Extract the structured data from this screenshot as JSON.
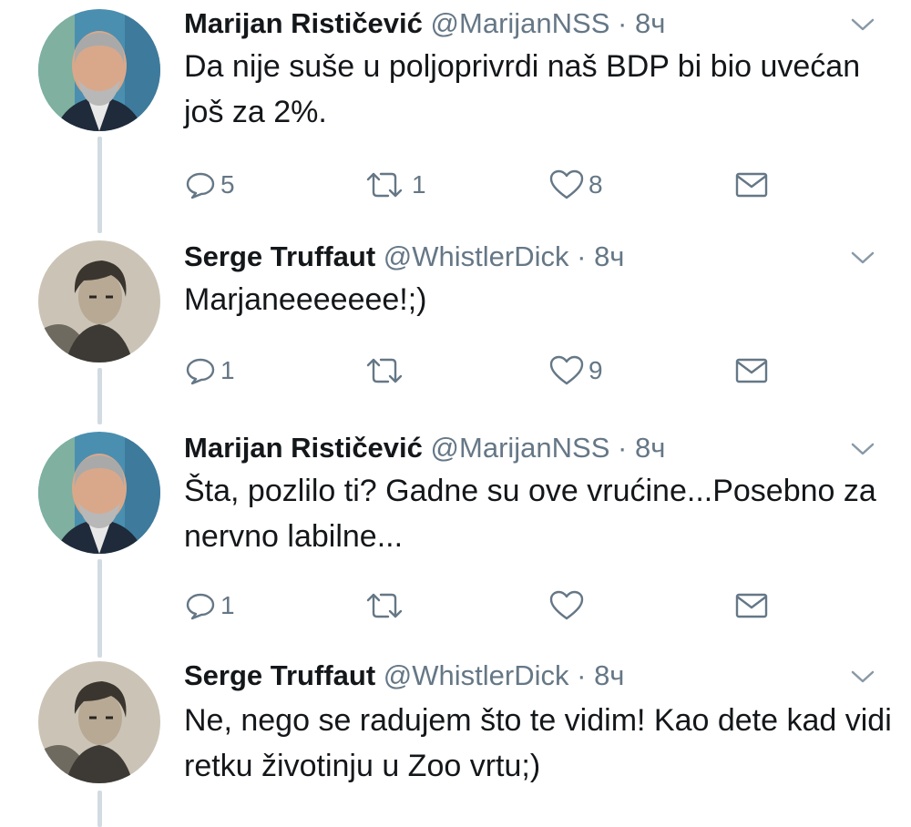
{
  "tweets": [
    {
      "author": "Marijan Rističević",
      "handle": "@MarijanNSS",
      "separator": "·",
      "time": "8ч",
      "text": "Da nije suše u poljoprivrdi naš BDP bi bio uvećan još za 2%.",
      "replies": "5",
      "retweets": "1",
      "likes": "8"
    },
    {
      "author": "Serge Truffaut",
      "handle": "@WhistlerDick",
      "separator": "·",
      "time": "8ч",
      "text": "Marjaneeeeeee!;)",
      "replies": "1",
      "retweets": "",
      "likes": "9"
    },
    {
      "author": "Marijan Rističević",
      "handle": "@MarijanNSS",
      "separator": "·",
      "time": "8ч",
      "text": "Šta, pozlilo ti? Gadne su ove vrućine...Posebno za nervno labilne...",
      "replies": "1",
      "retweets": "",
      "likes": ""
    },
    {
      "author": "Serge Truffaut",
      "handle": "@WhistlerDick",
      "separator": "·",
      "time": "8ч",
      "text": "Ne, nego se radujem što te vidim! Kao dete kad vidi retku životinju u Zoo vrtu;)",
      "replies": "",
      "retweets": "",
      "likes": ""
    }
  ],
  "icons": {
    "reply": "reply-icon",
    "retweet": "retweet-icon",
    "like": "heart-icon",
    "dm": "envelope-icon",
    "menu": "chevron-down-icon"
  },
  "colors": {
    "name": "#14171a",
    "secondary": "#657786",
    "thread_line": "#d3dbe2"
  }
}
